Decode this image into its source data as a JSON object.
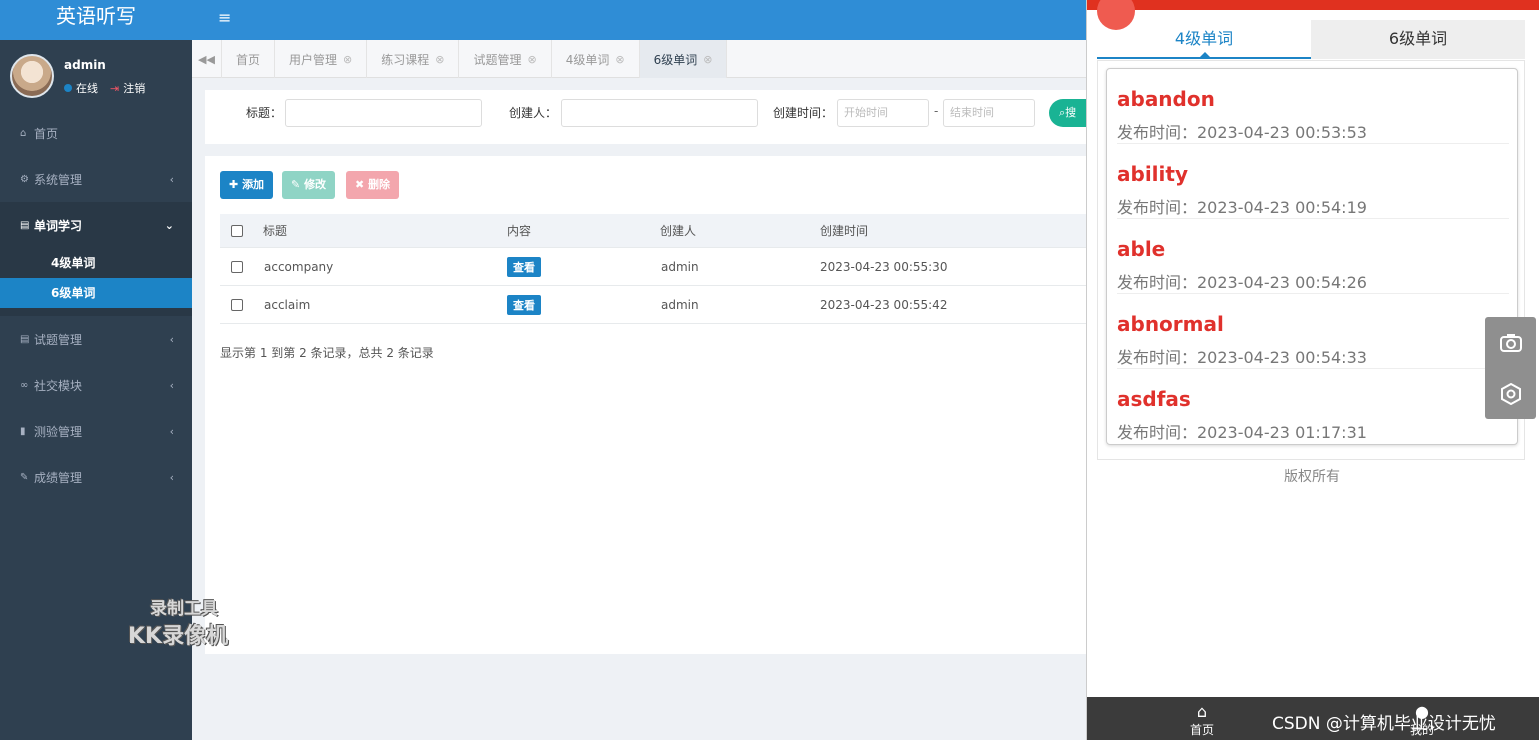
{
  "sidebar": {
    "logo": "英语听写",
    "user": {
      "name": "admin",
      "status": "在线",
      "logout": "注销"
    },
    "menu": [
      {
        "label": "首页",
        "icon": "home-icon"
      },
      {
        "label": "系统管理",
        "icon": "gear-icon"
      },
      {
        "label": "单词学习",
        "icon": "book-icon"
      },
      {
        "label": "试题管理",
        "icon": "book-icon"
      },
      {
        "label": "社交模块",
        "icon": "binoculars-icon"
      },
      {
        "label": "测验管理",
        "icon": "bookmark-icon"
      },
      {
        "label": "成绩管理",
        "icon": "edit-icon"
      }
    ],
    "submenu": [
      {
        "label": "4级单词"
      },
      {
        "label": "6级单词"
      }
    ],
    "watermark": {
      "line1": "录制工具",
      "line2": "KK录像机"
    }
  },
  "topbar": {
    "menu_icon": "hamburger-icon"
  },
  "tabs": [
    {
      "label": "首页"
    },
    {
      "label": "用户管理"
    },
    {
      "label": "练习课程"
    },
    {
      "label": "试题管理"
    },
    {
      "label": "4级单词"
    },
    {
      "label": "6级单词"
    }
  ],
  "search": {
    "title_label": "标题：",
    "creator_label": "创建人：",
    "time_label": "创建时间：",
    "start_placeholder": "开始时间",
    "end_placeholder": "结束时间",
    "dash": "-",
    "search_button": "搜"
  },
  "toolbar": {
    "add": "添加",
    "edit": "修改",
    "delete": "删除"
  },
  "table": {
    "headers": [
      "标题",
      "内容",
      "创建人",
      "创建时间"
    ],
    "rows": [
      {
        "title": "accompany",
        "content": "查看",
        "creator": "admin",
        "created": "2023-04-23 00:55:30"
      },
      {
        "title": "acclaim",
        "content": "查看",
        "creator": "admin",
        "created": "2023-04-23 00:55:42"
      }
    ],
    "footer": "显示第 1 到第 2 条记录，总共 2 条记录"
  },
  "mobile": {
    "tabs": [
      "4级单词",
      "6级单词"
    ],
    "words": [
      {
        "word": "abandon",
        "time": "发布时间：2023-04-23 00:53:53"
      },
      {
        "word": "ability",
        "time": "发布时间：2023-04-23 00:54:19"
      },
      {
        "word": "able",
        "time": "发布时间：2023-04-23 00:54:26"
      },
      {
        "word": "abnormal",
        "time": "发布时间：2023-04-23 00:54:33"
      },
      {
        "word": "asdfas",
        "time": "发布时间：2023-04-23 01:17:31"
      }
    ],
    "copyright": "版权所有",
    "nav": {
      "home": "首页",
      "mine": "我的"
    },
    "csdn": "CSDN @计算机毕业设计无忧"
  },
  "colors": {
    "primary": "#1c84c6",
    "sidebar": "#2f4050",
    "topbar": "#2f8dd6",
    "accent_red": "#e0312c",
    "success": "#1ab394"
  }
}
